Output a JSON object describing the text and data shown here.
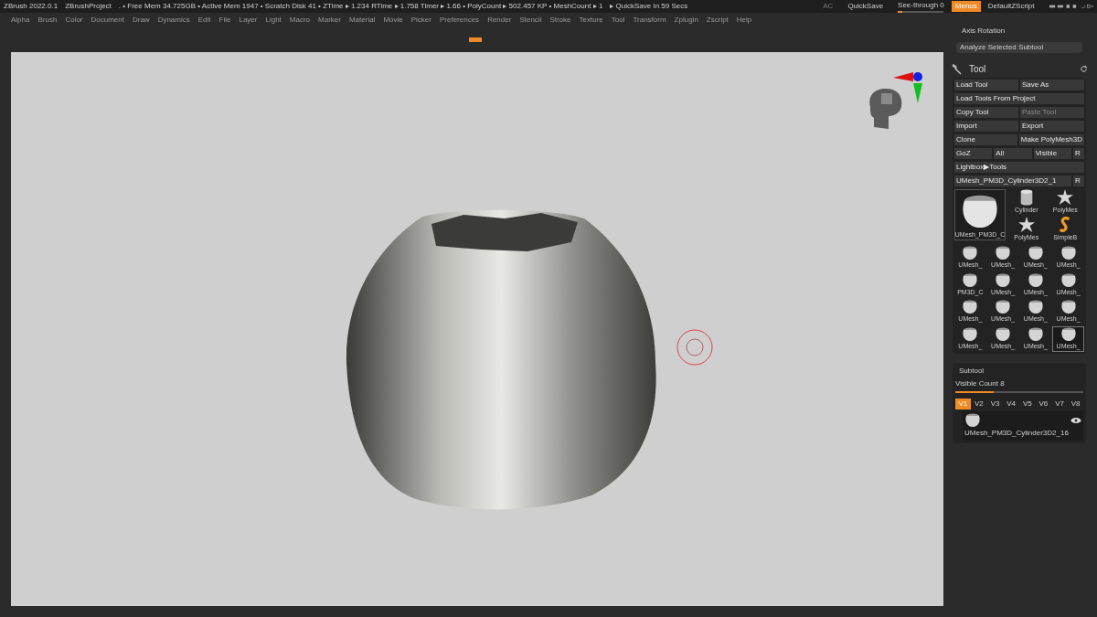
{
  "title_bar": {
    "app": "ZBrush 2022.0.1",
    "project": "ZBrushProject",
    "stats": ". • Free Mem 34.725GB • Active Mem 1947 • Scratch Disk 41 •  ZTime ▸ 1.234 RTime ▸ 1.758 Timer ▸ 1.66 • PolyCount ▸ 502.457 KP  • MeshCount ▸ 1",
    "quicksave_timer": "▸ QuickSave In 59 Secs",
    "ac": "AC",
    "quicksave": "QuickSave",
    "see_through": {
      "label": "See-through",
      "value": "0",
      "level": 0.1
    },
    "menus": {
      "label": "Menus",
      "on": true
    },
    "script": "DefaultZScript"
  },
  "menu_bar": [
    "Alpha",
    "Brush",
    "Color",
    "Document",
    "Draw",
    "Dynamics",
    "Edit",
    "File",
    "Layer",
    "Light",
    "Macro",
    "Marker",
    "Material",
    "Movie",
    "Picker",
    "Preferences",
    "Render",
    "Stencil",
    "Stroke",
    "Texture",
    "Tool",
    "Transform",
    "Zplugin",
    "Zscript",
    "Help"
  ],
  "right_panel": {
    "axis_rotation": "Axis Rotation",
    "analyze_button": "Analyze Selected Subtool",
    "tool_title": "Tool",
    "button_rows": [
      [
        {
          "label": "Load Tool",
          "disabled": false
        },
        {
          "label": "Save As",
          "disabled": false
        }
      ],
      [
        {
          "label": "Load Tools From Project",
          "disabled": false
        }
      ],
      [
        {
          "label": "Copy Tool",
          "disabled": false
        },
        {
          "label": "Paste Tool",
          "disabled": true
        }
      ],
      [
        {
          "label": "Import",
          "disabled": false
        },
        {
          "label": "Export",
          "disabled": false
        }
      ],
      [
        {
          "label": "Clone",
          "disabled": false
        },
        {
          "label": "Make PolyMesh3D",
          "disabled": false
        }
      ],
      [
        {
          "label": "GoZ",
          "disabled": false
        },
        {
          "label": "All",
          "disabled": false
        },
        {
          "label": "Visible",
          "disabled": false
        },
        {
          "label": "R",
          "disabled": false
        }
      ],
      [
        {
          "label": "Lightbox▶Tools",
          "disabled": false
        }
      ],
      [
        {
          "label": "UMesh_PM3D_Cylinder3D2_1",
          "disabled": false
        },
        {
          "label": "R",
          "disabled": false
        }
      ]
    ],
    "current_tool": "UMesh_PM3D_C",
    "side_tools": [
      {
        "label": "Cylinder",
        "kind": "cylinder"
      },
      {
        "label": "PolyMes",
        "kind": "star"
      },
      {
        "label": "PolyMes",
        "kind": "star"
      },
      {
        "label": "SimpleB",
        "kind": "snake"
      }
    ],
    "tool_thumbnails": [
      {
        "label": "UMesh_",
        "selected": false
      },
      {
        "label": "UMesh_",
        "selected": false
      },
      {
        "label": "UMesh_",
        "selected": false
      },
      {
        "label": "UMesh_",
        "selected": false
      },
      {
        "label": "PM3D_C",
        "selected": false
      },
      {
        "label": "UMesh_",
        "selected": false
      },
      {
        "label": "UMesh_",
        "selected": false
      },
      {
        "label": "UMesh_",
        "selected": false
      },
      {
        "label": "UMesh_",
        "selected": false
      },
      {
        "label": "UMesh_",
        "selected": false
      },
      {
        "label": "UMesh_",
        "selected": false
      },
      {
        "label": "UMesh_",
        "selected": false
      },
      {
        "label": "UMesh_",
        "selected": false
      },
      {
        "label": "UMesh_",
        "selected": false
      },
      {
        "label": "UMesh_",
        "selected": false
      },
      {
        "label": "UMesh_",
        "selected": true
      }
    ],
    "subtool": {
      "title": "Subtool",
      "visible_count": {
        "label": "Visible Count 8",
        "level": 0.3
      },
      "versions": [
        {
          "label": "V1",
          "selected": true
        },
        {
          "label": "V2",
          "selected": false
        },
        {
          "label": "V3",
          "selected": false
        },
        {
          "label": "V4",
          "selected": false
        },
        {
          "label": "V5",
          "selected": false
        },
        {
          "label": "V6",
          "selected": false
        },
        {
          "label": "V7",
          "selected": false
        },
        {
          "label": "V8",
          "selected": false
        }
      ],
      "items": [
        {
          "name": "UMesh_PM3D_Cylinder3D2_16"
        }
      ]
    }
  }
}
